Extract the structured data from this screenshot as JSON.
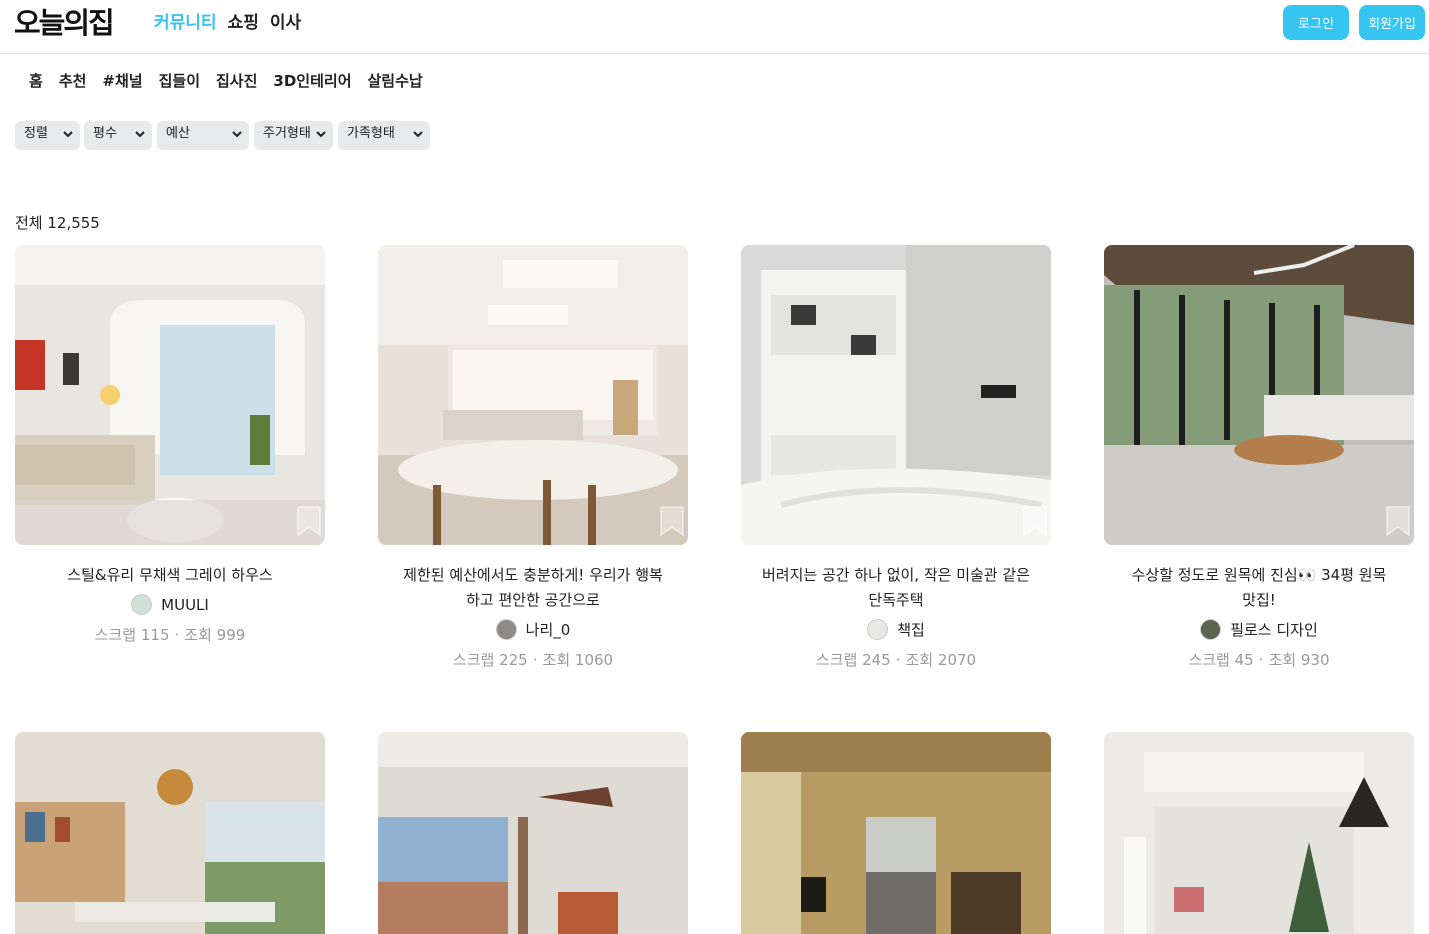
{
  "header": {
    "logo": "오늘의집",
    "gnb": [
      "커뮤니티",
      "쇼핑",
      "이사"
    ],
    "login_label": "로그인",
    "signup_label": "회원가입",
    "accent_color": "#35c5f0"
  },
  "subnav": [
    "홈",
    "추천",
    "#채널",
    "집들이",
    "집사진",
    "3D인테리어",
    "살림수납"
  ],
  "filters": [
    "정렬",
    "평수",
    "예산",
    "주거형태",
    "가족형태"
  ],
  "total": "전체 12,555",
  "stats_labels": {
    "scrap": "스크랩",
    "view": "조회"
  },
  "cards": [
    {
      "title": "스틸&유리 무채색 그레이 하우스",
      "author": "MUULI",
      "scrap": "115",
      "view": "999"
    },
    {
      "title": "제한된 예산에서도 충분하게! 우리가 행복하고 편안한 공간으로",
      "author": "나리_0",
      "scrap": "225",
      "view": "1060"
    },
    {
      "title": "버려지는 공간 하나 없이, 작은 미술관 같은 단독주택",
      "author": "책집",
      "scrap": "245",
      "view": "2070"
    },
    {
      "title": "수상할 정도로 원목에 진심👀 34평 원목 맛집!",
      "author": "필로스 디자인",
      "scrap": "45",
      "view": "930"
    },
    {
      "title": "",
      "author": "",
      "scrap": "",
      "view": ""
    },
    {
      "title": "",
      "author": "",
      "scrap": "",
      "view": ""
    },
    {
      "title": "",
      "author": "",
      "scrap": "",
      "view": ""
    },
    {
      "title": "",
      "author": "",
      "scrap": "",
      "view": ""
    }
  ]
}
